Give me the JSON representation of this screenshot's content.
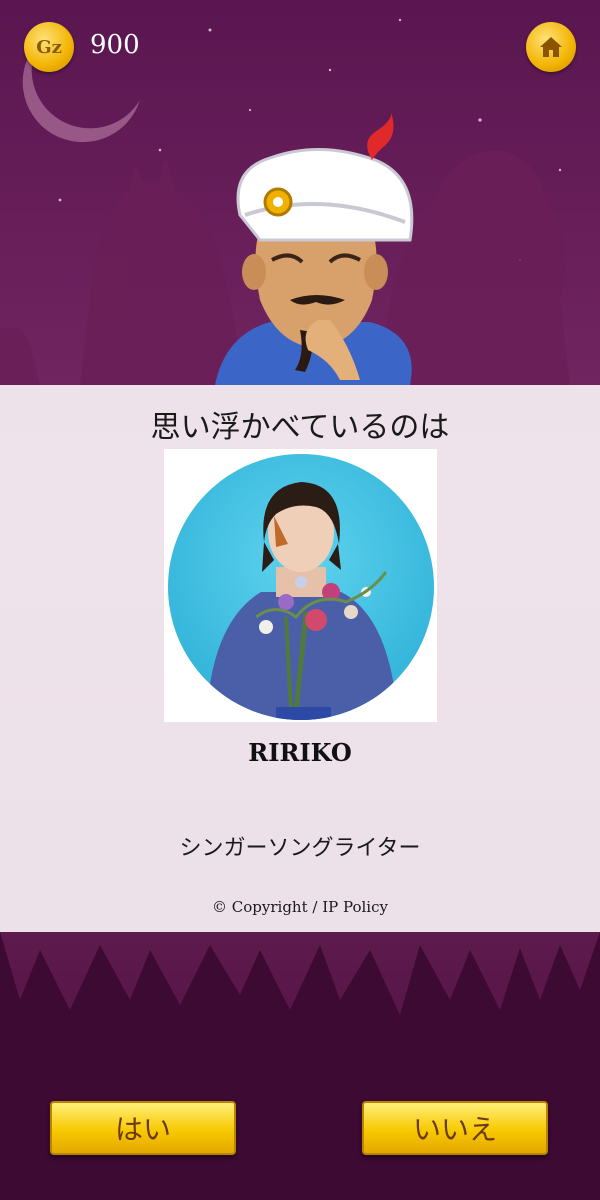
{
  "header": {
    "coin_icon_label": "Gz",
    "coin_count": "900"
  },
  "result": {
    "title": "思い浮かべているのは",
    "name": "RIRIKO",
    "description": "シンガーソングライター",
    "copyright": "© Copyright / IP Policy"
  },
  "buttons": {
    "yes_label": "はい",
    "no_label": "いいえ"
  },
  "icons": {
    "coin": "gz-coin-icon",
    "home": "home-icon"
  },
  "colors": {
    "background": "#5a1a4a",
    "button_gold": "#f7c900",
    "button_text": "#6b3a12"
  }
}
